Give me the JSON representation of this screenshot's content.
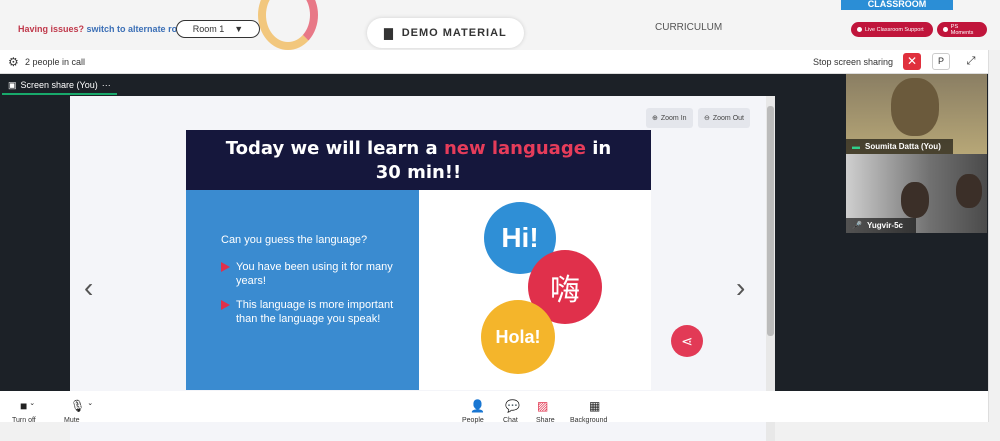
{
  "topbar": {
    "issues_text": "Having issues?",
    "alternate_room_link": "switch to alternate room",
    "room_select_value": "Room 1",
    "demo_material_label": "DEMO MATERIAL",
    "curriculum_label": "CURRICULUM",
    "classroom_tag": "CLASSROOM",
    "live_support_label": "Live Classroom Support",
    "ps_moments_label": "PS Moments"
  },
  "call": {
    "people_count": "2 people in call",
    "stop_sharing_label": "Stop screen sharing",
    "p_label": "P",
    "share_tab_label": "Screen share (You)",
    "share_tab_menu": "···"
  },
  "zoom": {
    "in_label": "Zoom In",
    "out_label": "Zoom Out"
  },
  "slide": {
    "title_part1": "Today we will learn a",
    "title_highlight": "new language",
    "title_part2": "in",
    "title_line2": "30 min!!",
    "question": "Can you guess the language?",
    "bullets": [
      "You have been using it for many years!",
      "This language is more important than the language you speak!"
    ],
    "bubble_hi": "Hi!",
    "bubble_chinese": "嗨",
    "bubble_hola": "Hola!"
  },
  "participants": [
    {
      "name": "Soumita Datta (You)"
    },
    {
      "name": "Yugvir-5c"
    }
  ],
  "toolbar": {
    "labels": [
      "Turn off",
      "Mute",
      "People",
      "Chat",
      "Share",
      "Background"
    ]
  },
  "colors": {
    "accent_red": "#e0304b",
    "slide_blue": "#3a8bd0",
    "slide_navy": "#15173c",
    "brand_crimson": "#c0153b"
  }
}
